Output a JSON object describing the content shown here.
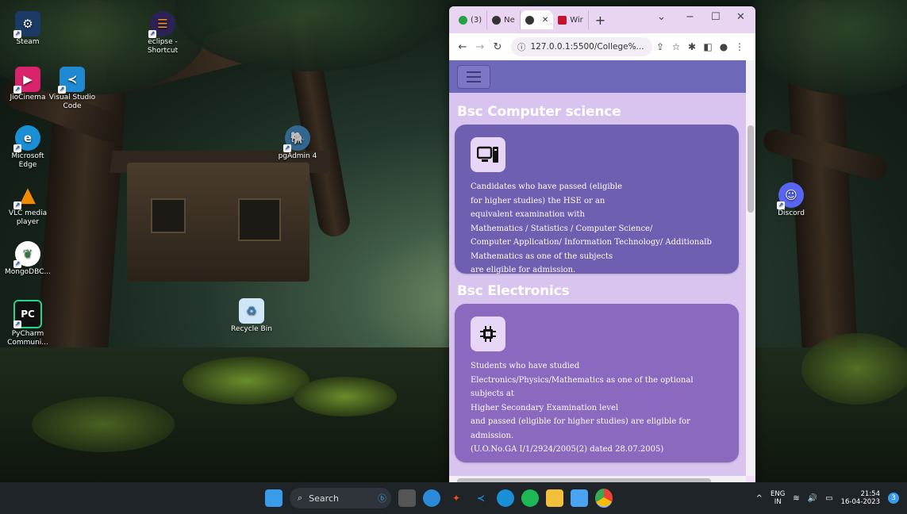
{
  "desktop_icons": [
    {
      "label": "Steam",
      "icon": "steam-icon",
      "color": "#1b3a66"
    },
    {
      "label": "eclipse - Shortcut",
      "icon": "eclipse-icon",
      "color": "#2c2255"
    },
    {
      "label": "JioCinema",
      "icon": "jiocinema-icon",
      "color": "#d9236c"
    },
    {
      "label": "Visual Studio Code",
      "icon": "vscode-icon",
      "color": "#1f8ad2"
    },
    {
      "label": "Microsoft Edge",
      "icon": "edge-icon",
      "color": "#1a8fd6"
    },
    {
      "label": "pgAdmin 4",
      "icon": "pgadmin-icon",
      "color": "#336791"
    },
    {
      "label": "VLC media player",
      "icon": "vlc-icon",
      "color": "#f08a00"
    },
    {
      "label": "Discord",
      "icon": "discord-icon",
      "color": "#5865f2"
    },
    {
      "label": "MongoDBC...",
      "icon": "mongodb-icon",
      "color": "#2c7a3a"
    },
    {
      "label": "PyCharm Communi...",
      "icon": "pycharm-icon",
      "color": "#111111"
    },
    {
      "label": "Recycle Bin",
      "icon": "recycle-bin-icon",
      "color": "#9ec8e8"
    }
  ],
  "browser": {
    "tabs": [
      {
        "label": "(3)",
        "icon": "whatsapp-icon",
        "color": "#25a244"
      },
      {
        "label": "Ne",
        "icon": "chatgpt-icon",
        "color": "#333333"
      },
      {
        "label": "",
        "icon": "chatgpt-icon",
        "color": "#333333"
      },
      {
        "label": "Wir",
        "icon": "mt-icon",
        "color": "#c4122f"
      }
    ],
    "new_tab": "+",
    "url": "127.0.0.1:5500/College%...",
    "window_controls": {
      "dropdown": "⌄",
      "minimize": "−",
      "maximize": "☐",
      "close": "✕"
    }
  },
  "page": {
    "sections": [
      {
        "title": "Bsc Computer science",
        "icon": "computer-icon",
        "lines": [
          "Candidates who have passed (eligible",
          "for higher studies) the HSE or an",
          "equivalent examination with",
          "Mathematics / Statistics / Computer Science/",
          "Computer Application/ Information Technology/ Additionalb",
          "Mathematics as one of the subjects",
          "are eligible for admission."
        ]
      },
      {
        "title": "Bsc Electronics",
        "icon": "chip-icon",
        "lines": [
          "Students who have studied",
          "Electronics/Physics/Mathematics as one of the optional",
          "subjects at",
          "Higher Secondary Examination level",
          "and passed (eligible for higher studies) are eligible for",
          "admission.",
          "(U.O.No.GA I/1/2924/2005(2) dated 28.07.2005)"
        ]
      }
    ]
  },
  "taskbar": {
    "search_label": "Search",
    "language_top": "ENG",
    "language_bottom": "IN",
    "time": "21:54",
    "date": "16-04-2023",
    "notification_count": "3"
  },
  "colors": {
    "navbar": "#6e68b9",
    "page_background": "#d9c3ef",
    "card_one": "#6f5fb0",
    "card_two": "#8a69bf",
    "taskbar": "#1f2428"
  }
}
